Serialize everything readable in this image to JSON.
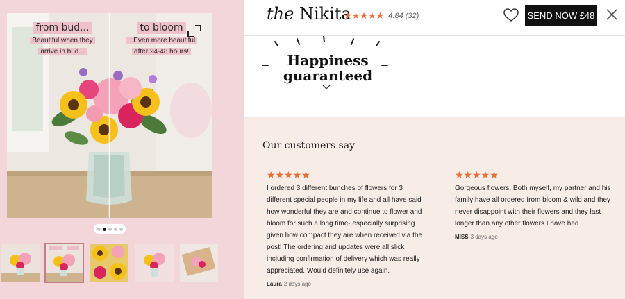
{
  "gallery": {
    "caption_left": {
      "title": "from bud...",
      "sub1": "Beautiful when they",
      "sub2": "arrive in bud..."
    },
    "caption_right": {
      "title": "to bloom",
      "sub1": "...Even more beautiful",
      "sub2": "after 24-48 hours!"
    },
    "active_dot": 2,
    "dot_count": 5,
    "active_thumb": 2,
    "thumb_count": 5
  },
  "header": {
    "title_prefix": "the",
    "title_name": "Nikita",
    "stars": "★★★★★",
    "rating": "4.84 (32)",
    "send_button": "SEND NOW £48"
  },
  "promo": {
    "line1": "Happiness",
    "line2": "guaranteed"
  },
  "reviews": {
    "heading": "Our customers say",
    "items": [
      {
        "stars": "★★★★★",
        "text": "I ordered 3 different bunches of flowers for 3 different special people in my life and all have said how wonderful they are and continue to flower and bloom for such a long time- especially surprising given how compact they are when received via the post! The ordering and updates were all slick including confirmation of delivery which was really appreciated. Would definitely use again.",
        "author": "Laura",
        "time": "2 days ago"
      },
      {
        "stars": "★★★★★",
        "text": "Gorgeous flowers. Both myself, my partner and his family have all ordered from bloom & wild and they never disappoint with their flowers and they last longer than any other flowers I have had",
        "author": "MISS",
        "time": "3 days ago"
      }
    ]
  },
  "colors": {
    "accent": "#e8713a",
    "gallery_bg": "#f3d6d9",
    "reviews_bg": "#f8ece7",
    "button_bg": "#111111"
  }
}
